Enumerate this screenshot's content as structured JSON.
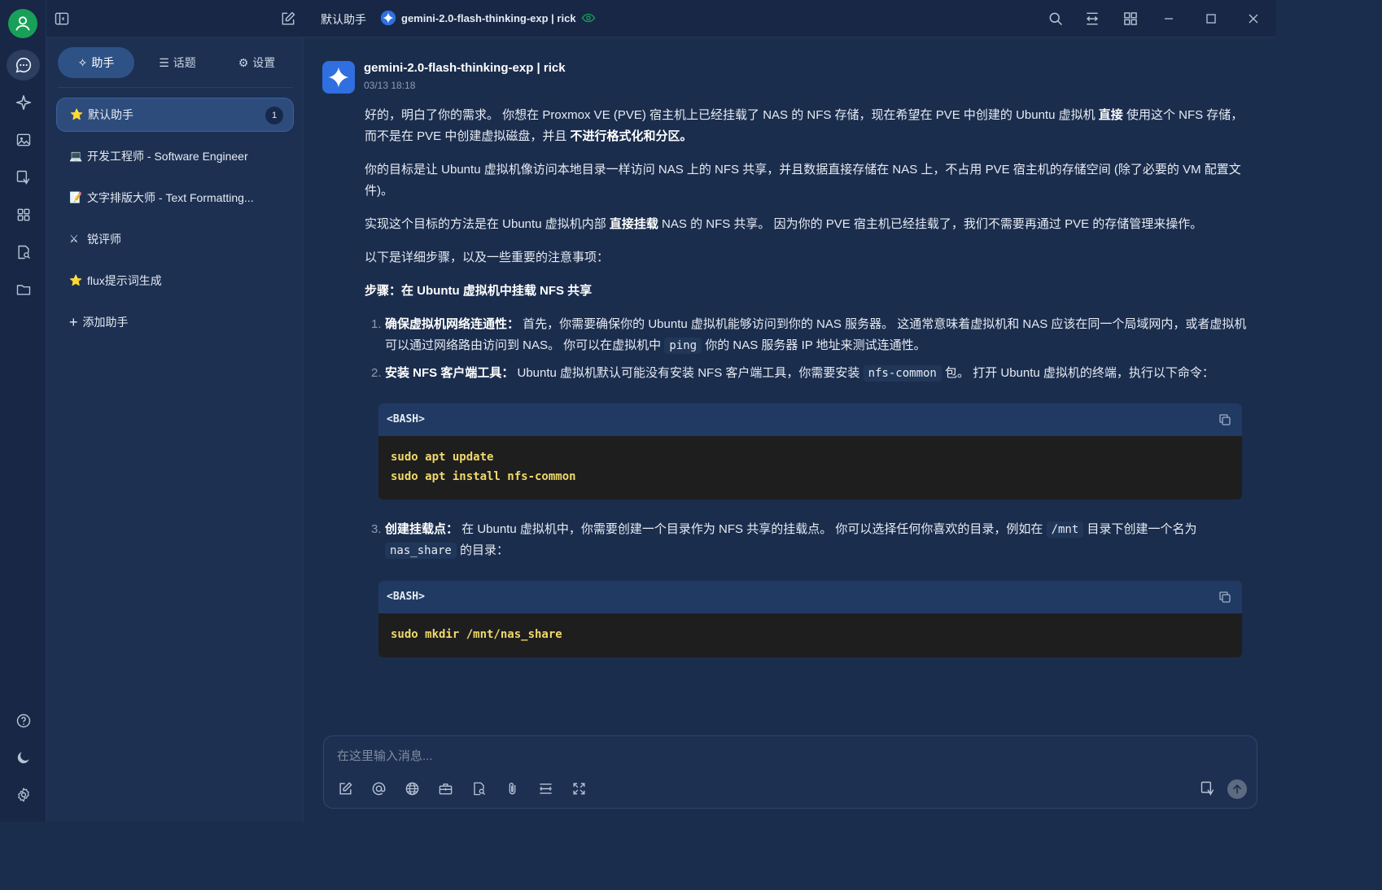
{
  "topbar": {
    "assistant_name": "默认助手",
    "model_label": "gemini-2.0-flash-thinking-exp | rick"
  },
  "sidebar": {
    "tabs": [
      {
        "label": "助手",
        "icon": "sparkle-icon",
        "active": true
      },
      {
        "label": "话题",
        "icon": "list-icon",
        "active": false
      },
      {
        "label": "设置",
        "icon": "gear-icon",
        "active": false
      }
    ],
    "assistants": [
      {
        "emoji": "⭐",
        "label": "默认助手",
        "count": "1",
        "active": true
      },
      {
        "emoji": "💻",
        "label": "开发工程师 - Software Engineer",
        "active": false
      },
      {
        "emoji": "📝",
        "label": "文字排版大师 - Text Formatting...",
        "active": false
      },
      {
        "emoji": "⚔",
        "label": "锐评师",
        "active": false
      },
      {
        "emoji": "⭐",
        "label": "flux提示词生成",
        "active": false
      }
    ],
    "add_label": "添加助手"
  },
  "message": {
    "author": "gemini-2.0-flash-thinking-exp | rick",
    "time": "03/13 18:18",
    "p1_a": "好的，明白了你的需求。 你想在 Proxmox VE (PVE) 宿主机上已经挂载了 NAS 的 NFS 存储，现在希望在 PVE 中创建的 Ubuntu 虚拟机 ",
    "p1_b": "直接",
    "p1_c": " 使用这个 NFS 存储，而不是在 PVE 中创建虚拟磁盘，并且 ",
    "p1_d": "不进行格式化和分区。",
    "p2": "你的目标是让 Ubuntu 虚拟机像访问本地目录一样访问 NAS 上的 NFS 共享，并且数据直接存储在 NAS 上，不占用 PVE 宿主机的存储空间 (除了必要的 VM 配置文件)。",
    "p3_a": "实现这个目标的方法是在 Ubuntu 虚拟机内部 ",
    "p3_b": "直接挂载",
    "p3_c": " NAS 的 NFS 共享。 因为你的 PVE 宿主机已经挂载了，我们不需要再通过 PVE 的存储管理来操作。",
    "p4": "以下是详细步骤，以及一些重要的注意事项：",
    "heading": "步骤：在 Ubuntu 虚拟机中挂载 NFS 共享",
    "step1_num": "1.",
    "step1_title": "确保虚拟机网络连通性：",
    "step1_a": " 首先，你需要确保你的 Ubuntu 虚拟机能够访问到你的 NAS 服务器。 这通常意味着虚拟机和 NAS 应该在同一个局域网内，或者虚拟机可以通过网络路由访问到 NAS。 你可以在虚拟机中 ",
    "step1_code": "ping",
    "step1_b": " 你的 NAS 服务器 IP 地址来测试连通性。",
    "step2_num": "2.",
    "step2_title": "安装 NFS 客户端工具：",
    "step2_a": " Ubuntu 虚拟机默认可能没有安装 NFS 客户端工具，你需要安装 ",
    "step2_code": "nfs-common",
    "step2_b": " 包。 打开 Ubuntu 虚拟机的终端，执行以下命令：",
    "code1_lang": "<BASH>",
    "code1": "sudo apt update\nsudo apt install nfs-common",
    "step3_num": "3.",
    "step3_title": "创建挂载点：",
    "step3_a": " 在 Ubuntu 虚拟机中，你需要创建一个目录作为 NFS 共享的挂载点。 你可以选择任何你喜欢的目录，例如在 ",
    "step3_code1": "/mnt",
    "step3_b": " 目录下创建一个名为 ",
    "step3_code2": "nas_share",
    "step3_c": " 的目录：",
    "code2_lang": "<BASH>",
    "code2": "sudo mkdir /mnt/nas_share"
  },
  "composer": {
    "placeholder": "在这里输入消息..."
  },
  "colors": {
    "accent": "#2e5286",
    "online": "#18a058",
    "code_text": "#f0d96b"
  }
}
